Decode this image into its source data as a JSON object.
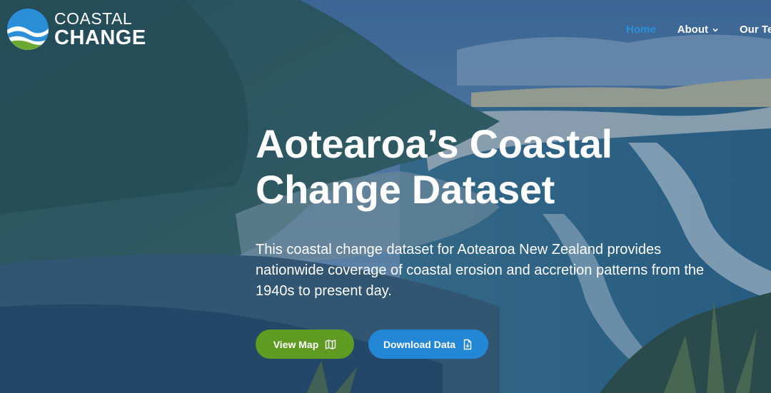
{
  "brand": {
    "line1": "COASTAL",
    "line2": "CHANGE",
    "colors": {
      "blue": "#2b8fd8",
      "green": "#6aa832"
    }
  },
  "nav": {
    "items": [
      {
        "label": "Home",
        "active": true
      },
      {
        "label": "About",
        "dropdown": true
      },
      {
        "label": "Our Tea"
      }
    ]
  },
  "hero": {
    "title_line1": "Aotearoa’s Coastal",
    "title_line2": "Change Dataset",
    "description": "This coastal change dataset for Aotearoa New Zealand provides nationwide coverage of coastal erosion and accretion patterns from the 1940s to present day.",
    "buttons": [
      {
        "label": "View Map",
        "icon": "map-icon",
        "color": "#5f9a23"
      },
      {
        "label": "Download Data",
        "icon": "document-icon",
        "color": "#2288d6"
      }
    ]
  }
}
